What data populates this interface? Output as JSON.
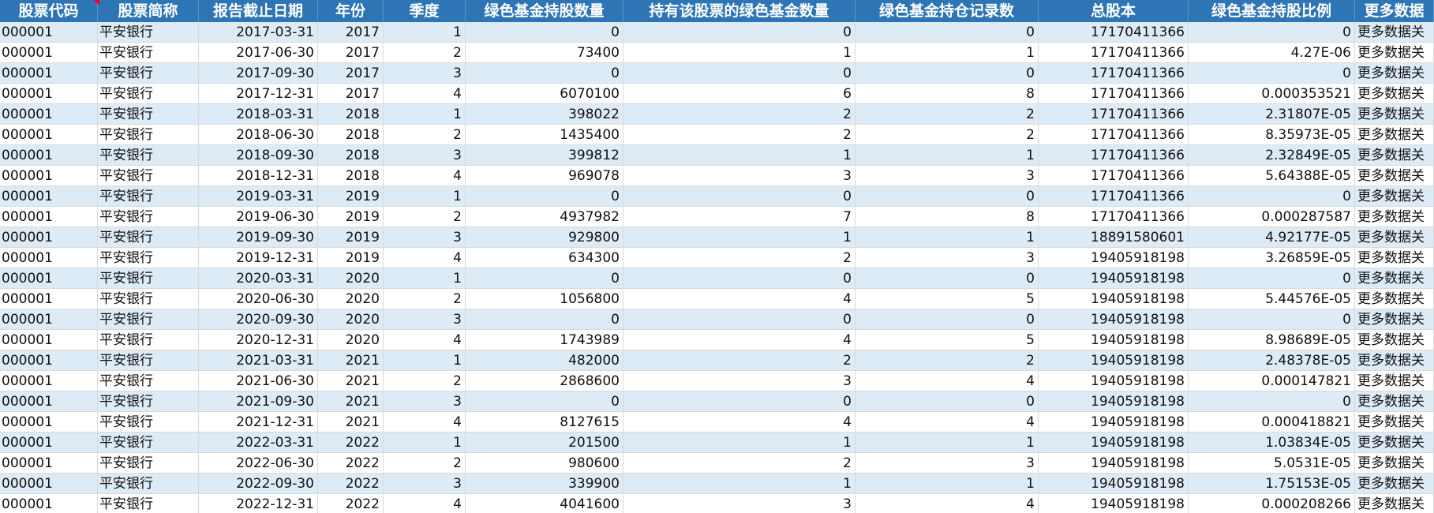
{
  "columns": [
    "股票代码",
    "股票简称",
    "报告截止日期",
    "年份",
    "季度",
    "绿色基金持股数量",
    "持有该股票的绿色基金数量",
    "绿色基金持仓记录数",
    "总股本",
    "绿色基金持股比例",
    "更多数据"
  ],
  "rows": [
    [
      "000001",
      "平安银行",
      "2017-03-31",
      "2017",
      "1",
      "0",
      "0",
      "0",
      "17170411366",
      "0",
      "更多数据关"
    ],
    [
      "000001",
      "平安银行",
      "2017-06-30",
      "2017",
      "2",
      "73400",
      "1",
      "1",
      "17170411366",
      "4.27E-06",
      "更多数据关"
    ],
    [
      "000001",
      "平安银行",
      "2017-09-30",
      "2017",
      "3",
      "0",
      "0",
      "0",
      "17170411366",
      "0",
      "更多数据关"
    ],
    [
      "000001",
      "平安银行",
      "2017-12-31",
      "2017",
      "4",
      "6070100",
      "6",
      "8",
      "17170411366",
      "0.000353521",
      "更多数据关"
    ],
    [
      "000001",
      "平安银行",
      "2018-03-31",
      "2018",
      "1",
      "398022",
      "2",
      "2",
      "17170411366",
      "2.31807E-05",
      "更多数据关"
    ],
    [
      "000001",
      "平安银行",
      "2018-06-30",
      "2018",
      "2",
      "1435400",
      "2",
      "2",
      "17170411366",
      "8.35973E-05",
      "更多数据关"
    ],
    [
      "000001",
      "平安银行",
      "2018-09-30",
      "2018",
      "3",
      "399812",
      "1",
      "1",
      "17170411366",
      "2.32849E-05",
      "更多数据关"
    ],
    [
      "000001",
      "平安银行",
      "2018-12-31",
      "2018",
      "4",
      "969078",
      "3",
      "3",
      "17170411366",
      "5.64388E-05",
      "更多数据关"
    ],
    [
      "000001",
      "平安银行",
      "2019-03-31",
      "2019",
      "1",
      "0",
      "0",
      "0",
      "17170411366",
      "0",
      "更多数据关"
    ],
    [
      "000001",
      "平安银行",
      "2019-06-30",
      "2019",
      "2",
      "4937982",
      "7",
      "8",
      "17170411366",
      "0.000287587",
      "更多数据关"
    ],
    [
      "000001",
      "平安银行",
      "2019-09-30",
      "2019",
      "3",
      "929800",
      "1",
      "1",
      "18891580601",
      "4.92177E-05",
      "更多数据关"
    ],
    [
      "000001",
      "平安银行",
      "2019-12-31",
      "2019",
      "4",
      "634300",
      "2",
      "3",
      "19405918198",
      "3.26859E-05",
      "更多数据关"
    ],
    [
      "000001",
      "平安银行",
      "2020-03-31",
      "2020",
      "1",
      "0",
      "0",
      "0",
      "19405918198",
      "0",
      "更多数据关"
    ],
    [
      "000001",
      "平安银行",
      "2020-06-30",
      "2020",
      "2",
      "1056800",
      "4",
      "5",
      "19405918198",
      "5.44576E-05",
      "更多数据关"
    ],
    [
      "000001",
      "平安银行",
      "2020-09-30",
      "2020",
      "3",
      "0",
      "0",
      "0",
      "19405918198",
      "0",
      "更多数据关"
    ],
    [
      "000001",
      "平安银行",
      "2020-12-31",
      "2020",
      "4",
      "1743989",
      "4",
      "5",
      "19405918198",
      "8.98689E-05",
      "更多数据关"
    ],
    [
      "000001",
      "平安银行",
      "2021-03-31",
      "2021",
      "1",
      "482000",
      "2",
      "2",
      "19405918198",
      "2.48378E-05",
      "更多数据关"
    ],
    [
      "000001",
      "平安银行",
      "2021-06-30",
      "2021",
      "2",
      "2868600",
      "3",
      "4",
      "19405918198",
      "0.000147821",
      "更多数据关"
    ],
    [
      "000001",
      "平安银行",
      "2021-09-30",
      "2021",
      "3",
      "0",
      "0",
      "0",
      "19405918198",
      "0",
      "更多数据关"
    ],
    [
      "000001",
      "平安银行",
      "2021-12-31",
      "2021",
      "4",
      "8127615",
      "4",
      "4",
      "19405918198",
      "0.000418821",
      "更多数据关"
    ],
    [
      "000001",
      "平安银行",
      "2022-03-31",
      "2022",
      "1",
      "201500",
      "1",
      "1",
      "19405918198",
      "1.03834E-05",
      "更多数据关"
    ],
    [
      "000001",
      "平安银行",
      "2022-06-30",
      "2022",
      "2",
      "980600",
      "2",
      "3",
      "19405918198",
      "5.0531E-05",
      "更多数据关"
    ],
    [
      "000001",
      "平安银行",
      "2022-09-30",
      "2022",
      "3",
      "339900",
      "1",
      "1",
      "19405918198",
      "1.75153E-05",
      "更多数据关"
    ],
    [
      "000001",
      "平安银行",
      "2022-12-31",
      "2022",
      "4",
      "4041600",
      "3",
      "4",
      "19405918198",
      "0.000208266",
      "更多数据关"
    ]
  ],
  "colors": {
    "header_bg": "#2e75b6",
    "band_bg": "#ddebf7",
    "comment_marker": "#ff0000"
  }
}
